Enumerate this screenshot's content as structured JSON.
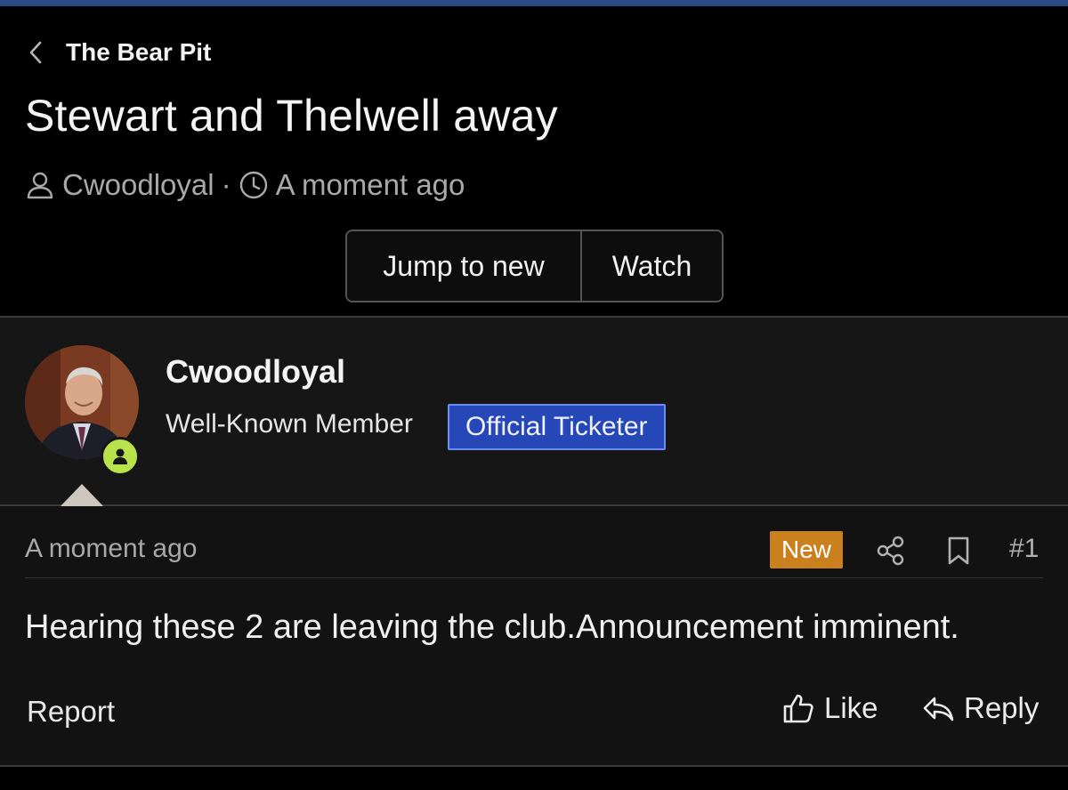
{
  "nav": {
    "back_label": "The Bear Pit"
  },
  "thread": {
    "title": "Stewart and Thelwell away",
    "author": "Cwoodloyal",
    "separator": "·",
    "time": "A moment ago"
  },
  "actions": {
    "jump_label": "Jump to new",
    "watch_label": "Watch"
  },
  "post": {
    "username": "Cwoodloyal",
    "role": "Well-Known Member",
    "badge": "Official Ticketer",
    "time": "A moment ago",
    "new_label": "New",
    "number": "#1",
    "body": "Hearing these 2 are leaving the club.Announcement imminent.",
    "report_label": "Report",
    "like_label": "Like",
    "reply_label": "Reply"
  },
  "icons": {
    "back": "chevron-left-icon",
    "user": "user-icon",
    "clock": "clock-icon",
    "online": "online-status-icon",
    "share": "share-icon",
    "bookmark": "bookmark-icon",
    "like": "thumbs-up-icon",
    "reply": "reply-icon"
  },
  "colors": {
    "top_accent": "#2b4a84",
    "badge_bg": "#2547b8",
    "new_badge_bg": "#c9801d",
    "online_green": "#b8e34a"
  }
}
